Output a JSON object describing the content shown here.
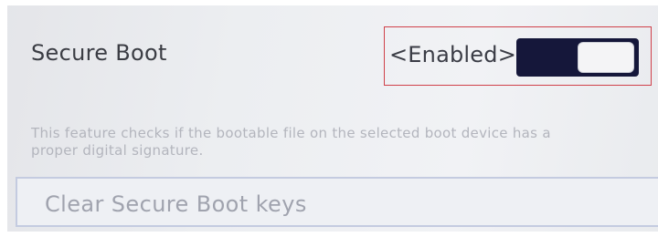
{
  "secure_boot": {
    "label": "Secure Boot",
    "state_label": "<Enabled>",
    "enabled": true,
    "description": "This feature checks if the bootable file on the selected boot device has a proper digital signature."
  },
  "actions": {
    "clear_keys_label": "Clear Secure Boot keys"
  },
  "colors": {
    "toggle_on": "#15173a",
    "highlight_border": "#d0414a",
    "row_border": "#c4cbe0"
  }
}
